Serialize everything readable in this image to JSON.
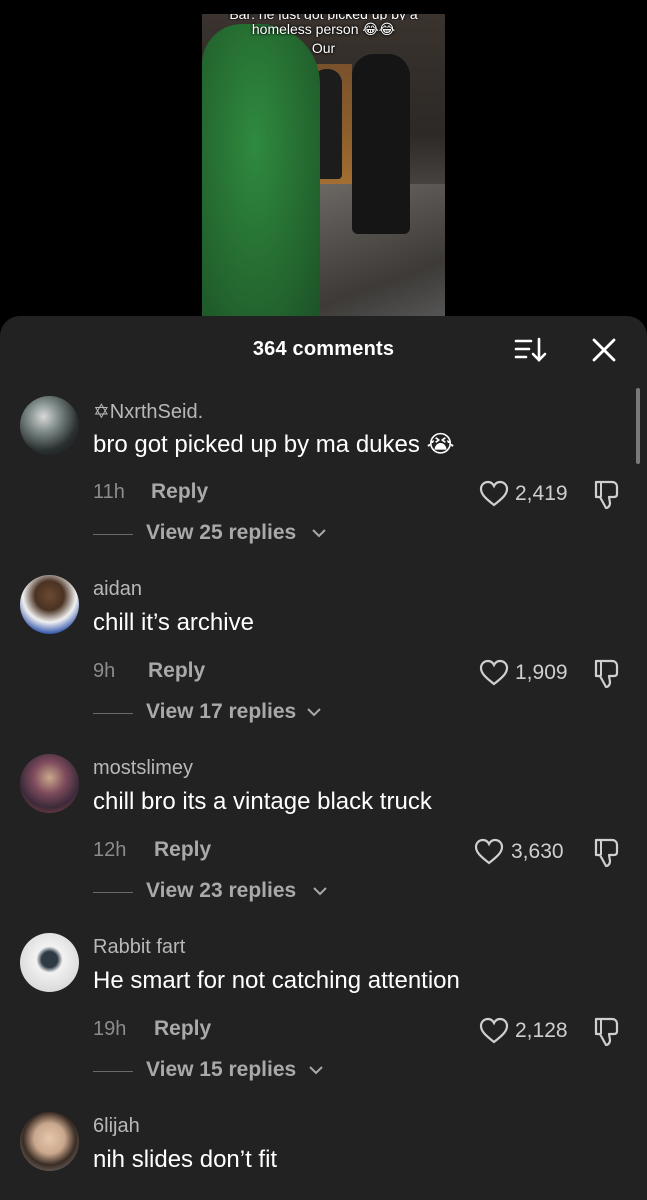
{
  "video": {
    "caption_line1_partial": "Bar: he just got picked up by a",
    "caption_line2": "homeless person 😂😂",
    "caption_line3": "Our"
  },
  "header": {
    "title": "364 comments"
  },
  "comments": [
    {
      "username": "✡NxrthSeid.",
      "text": "bro got picked up by ma dukes 😭",
      "time": "11h",
      "reply": "Reply",
      "likes": "2,419",
      "view_replies": "View 25 replies"
    },
    {
      "username": "aidan",
      "text": "chill it’s archive",
      "time": "9h",
      "reply": "Reply",
      "likes": "1,909",
      "view_replies": "View 17 replies"
    },
    {
      "username": "mostslimey",
      "text": "chill bro its a vintage black truck",
      "time": "12h",
      "reply": "Reply",
      "likes": "3,630",
      "view_replies": "View 23 replies"
    },
    {
      "username": "Rabbit fart",
      "text": "He smart for not catching attention",
      "time": "19h",
      "reply": "Reply",
      "likes": "2,128",
      "view_replies": "View 15 replies"
    },
    {
      "username": "6lijah",
      "text": "nih slides don’t fit"
    }
  ]
}
